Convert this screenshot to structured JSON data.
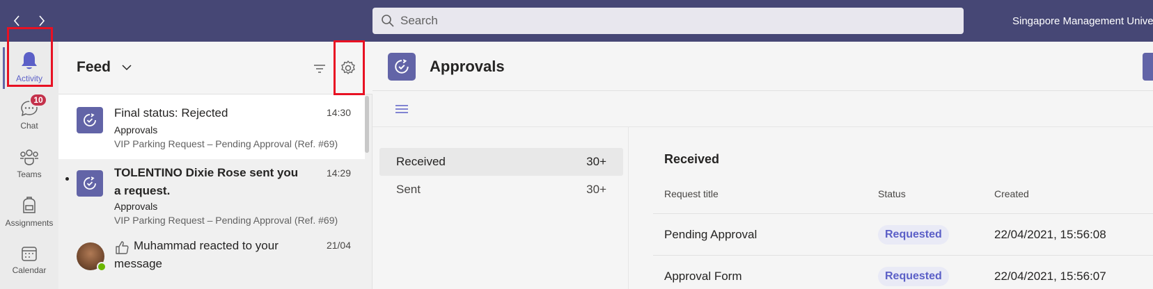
{
  "topbar": {
    "search_placeholder": "Search",
    "org_name": "Singapore Management Univer"
  },
  "rail": {
    "items": [
      {
        "label": "Activity"
      },
      {
        "label": "Chat",
        "badge": "10"
      },
      {
        "label": "Teams"
      },
      {
        "label": "Assignments"
      },
      {
        "label": "Calendar"
      }
    ]
  },
  "feed": {
    "title": "Feed",
    "items": [
      {
        "title": "Final status: Rejected",
        "time": "14:30",
        "app": "Approvals",
        "desc": "VIP Parking Request – Pending Approval (Ref. #69)"
      },
      {
        "title": "TOLENTINO Dixie Rose sent you a request.",
        "time": "14:29",
        "app": "Approvals",
        "desc": "VIP Parking Request – Pending Approval (Ref. #69)"
      },
      {
        "title": "Muhammad reacted to your message",
        "time": "21/04"
      }
    ]
  },
  "approvals": {
    "title": "Approvals",
    "nav": [
      {
        "label": "Received",
        "count": "30+"
      },
      {
        "label": "Sent",
        "count": "30+"
      }
    ],
    "section_title": "Received",
    "columns": {
      "title": "Request title",
      "status": "Status",
      "created": "Created"
    },
    "rows": [
      {
        "title": "Pending Approval",
        "status": "Requested",
        "created": "22/04/2021, 15:56:08"
      },
      {
        "title": "Approval Form",
        "status": "Requested",
        "created": "22/04/2021, 15:56:07"
      }
    ]
  },
  "colors": {
    "topbar": "#464775",
    "accent": "#6264a7",
    "highlight_box": "#e81123",
    "badge": "#c4314b"
  }
}
